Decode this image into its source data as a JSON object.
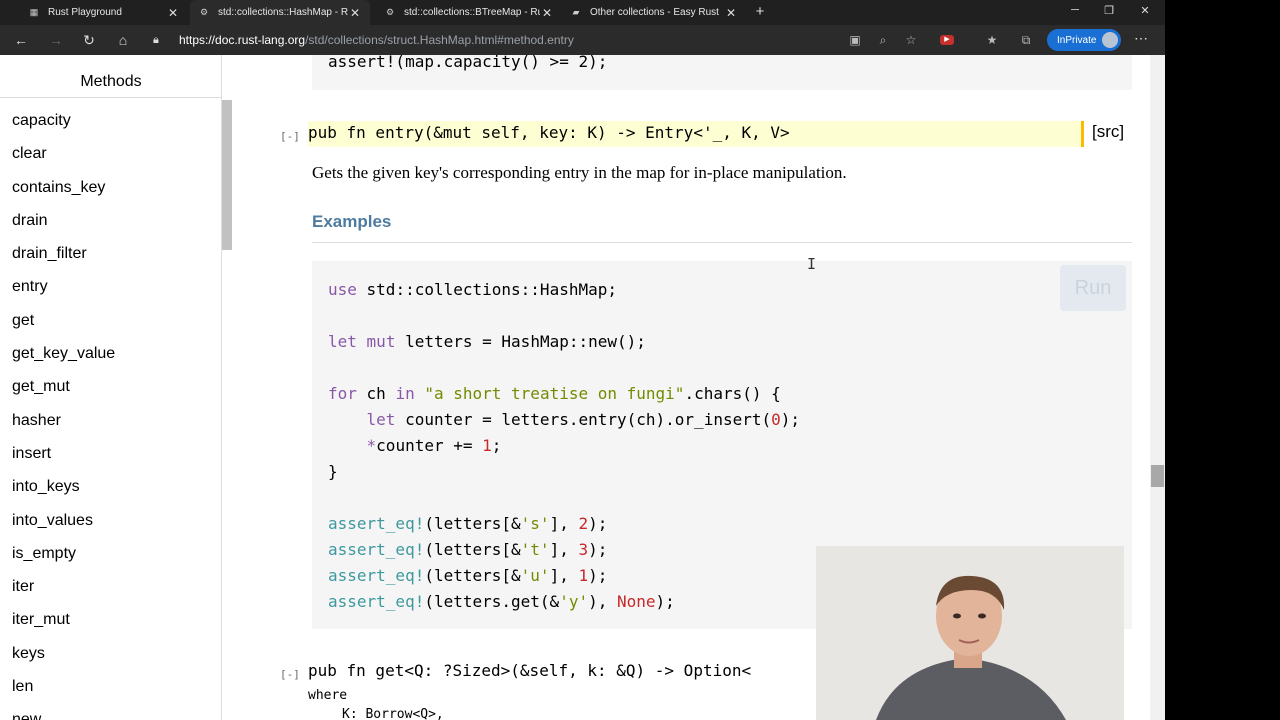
{
  "browser": {
    "tabs": [
      {
        "label": "Rust Playground",
        "icon": "rust-playground-icon",
        "active": false
      },
      {
        "label": "std::collections::HashMap - Rust",
        "icon": "rust-icon",
        "active": true
      },
      {
        "label": "std::collections::BTreeMap - Rust",
        "icon": "rust-icon",
        "active": false
      },
      {
        "label": "Other collections - Easy Rust",
        "icon": "book-icon",
        "active": false
      }
    ],
    "tab_close": "✕",
    "new_tab": "+",
    "url_host": "https://doc.rust-lang.org",
    "url_path": "/std/collections/struct.HashMap.html#method.entry",
    "inprivate_label": "InPrivate",
    "accent_color": "#1a6fd4"
  },
  "sidebar": {
    "title": "Methods",
    "items": [
      "capacity",
      "clear",
      "contains_key",
      "drain",
      "drain_filter",
      "entry",
      "get",
      "get_key_value",
      "get_mut",
      "hasher",
      "insert",
      "into_keys",
      "into_values",
      "is_empty",
      "iter",
      "iter_mut",
      "keys",
      "len",
      "new"
    ]
  },
  "content": {
    "top_code": "assert!(map.capacity() >= 2);",
    "entry": {
      "toggle": "[-]",
      "signature": "pub fn entry(&mut self, key: K) -> Entry<'_, K, V>",
      "src": "[src]",
      "doc": "Gets the given key's corresponding entry in the map for in-place manipulation.",
      "examples_heading": "Examples",
      "run_label": "Run",
      "code": [
        "use std::collections::HashMap;",
        "",
        "let mut letters = HashMap::new();",
        "",
        "for ch in \"a short treatise on fungi\".chars() {",
        "    let counter = letters.entry(ch).or_insert(0);",
        "    *counter += 1;",
        "}",
        "",
        "assert_eq!(letters[&'s'], 2);",
        "assert_eq!(letters[&'t'], 3);",
        "assert_eq!(letters[&'u'], 1);",
        "assert_eq!(letters.get(&'y'), None);"
      ]
    },
    "get": {
      "toggle": "[-]",
      "signature": "pub fn get<Q: ?Sized>(&self, k: &Q) -> Option<",
      "src": "]",
      "where": "where",
      "bound": "K: Borrow<Q>,"
    }
  }
}
